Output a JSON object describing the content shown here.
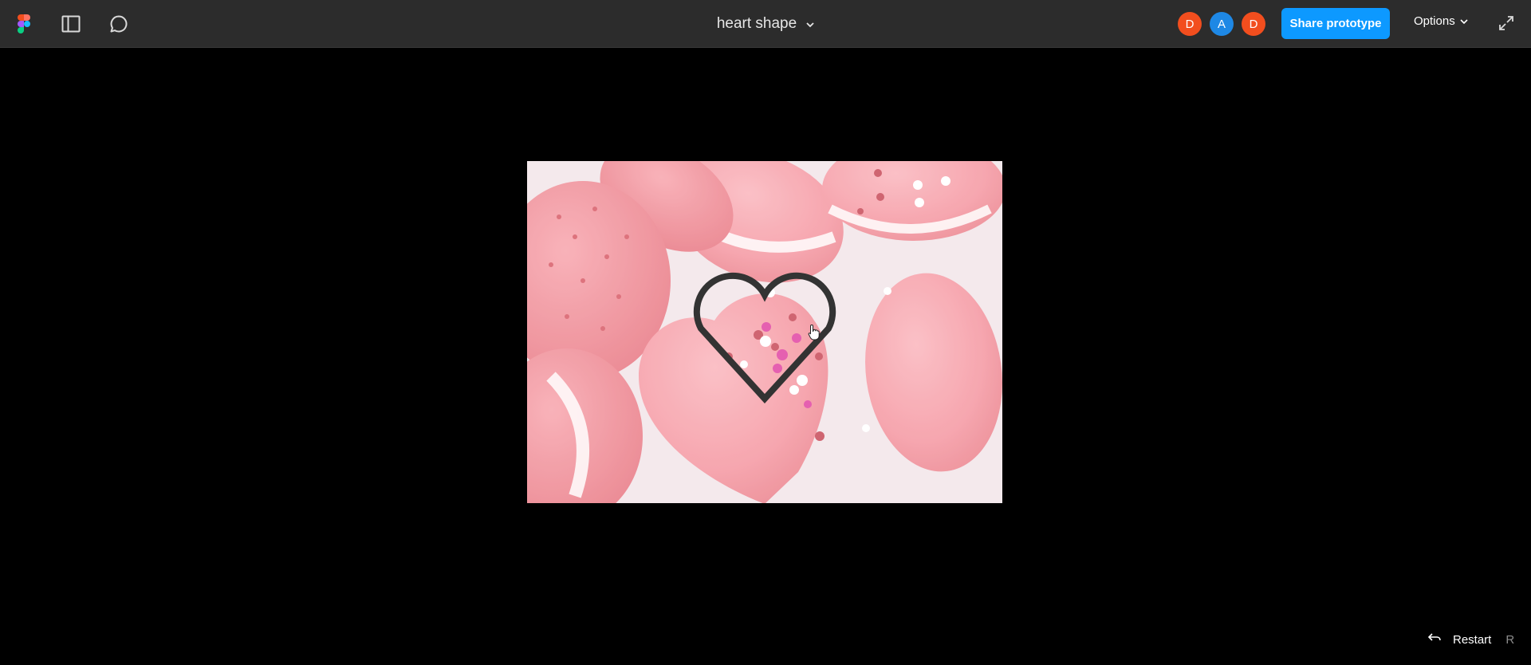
{
  "header": {
    "title": "heart shape",
    "avatars": [
      {
        "initial": "D",
        "color": "#f24e1e"
      },
      {
        "initial": "A",
        "color": "#1e88e5"
      },
      {
        "initial": "D",
        "color": "#f24e1e"
      }
    ],
    "share_label": "Share prototype",
    "share_color": "#0d99ff",
    "options_label": "Options"
  },
  "footer": {
    "restart_label": "Restart",
    "restart_key": "R"
  },
  "icons": {
    "logo": "figma-logo",
    "sidebar": "sidebar-toggle-icon",
    "comment": "comment-icon",
    "title_chevron": "chevron-down-icon",
    "options_chevron": "chevron-down-icon",
    "expand": "expand-icon",
    "restart": "restart-arrow-icon",
    "cursor": "hand-cursor-icon"
  }
}
